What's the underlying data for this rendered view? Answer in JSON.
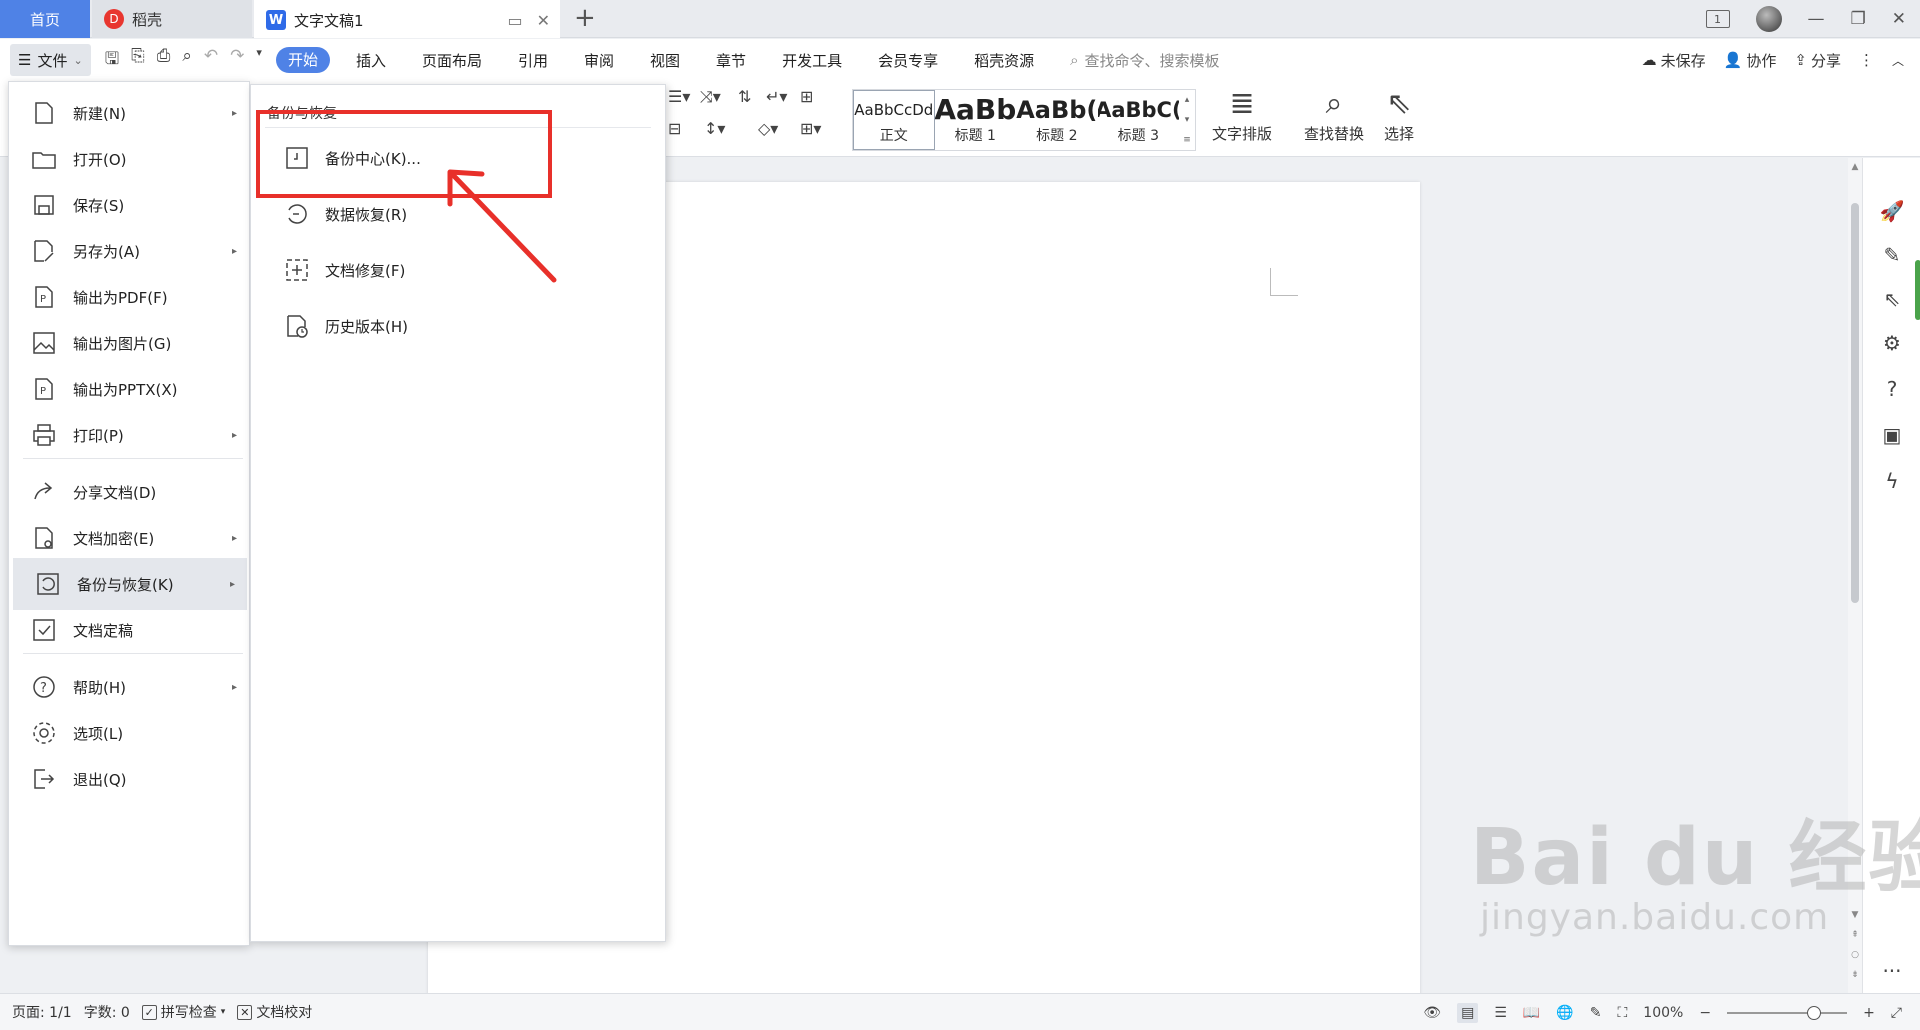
{
  "tabs": {
    "home": "首页",
    "daoke": "稻壳",
    "document": "文字文稿1",
    "new_tab": "+"
  },
  "window": {
    "badge": "1"
  },
  "menu": {
    "file_label": "文件",
    "ribbon_tabs": [
      "开始",
      "插入",
      "页面布局",
      "引用",
      "审阅",
      "视图",
      "章节",
      "开发工具",
      "会员专享",
      "稻壳资源"
    ],
    "search_placeholder": "查找命令、搜索模板",
    "unsaved": "未保存",
    "collab": "协作",
    "share": "分享"
  },
  "ribbon": {
    "styles": [
      {
        "sample": "AaBbCcDd",
        "label": "正文"
      },
      {
        "sample": "AaBb",
        "label": "标题 1"
      },
      {
        "sample": "AaBb(",
        "label": "标题 2"
      },
      {
        "sample": "AaBbC(",
        "label": "标题 3"
      }
    ],
    "text_layout": "文字排版",
    "find_replace": "查找替换",
    "select": "选择"
  },
  "file_menu": {
    "items": [
      {
        "label": "新建(N)",
        "icon": "new-doc-icon",
        "submenu": true
      },
      {
        "label": "打开(O)",
        "icon": "folder-open-icon",
        "submenu": false
      },
      {
        "label": "保存(S)",
        "icon": "save-icon",
        "submenu": false
      },
      {
        "label": "另存为(A)",
        "icon": "save-as-icon",
        "submenu": true
      },
      {
        "label": "输出为PDF(F)",
        "icon": "pdf-export-icon",
        "submenu": false
      },
      {
        "label": "输出为图片(G)",
        "icon": "image-export-icon",
        "submenu": false
      },
      {
        "label": "输出为PPTX(X)",
        "icon": "pptx-export-icon",
        "submenu": false
      },
      {
        "label": "打印(P)",
        "icon": "printer-icon",
        "submenu": true
      },
      {
        "label": "分享文档(D)",
        "icon": "share-icon",
        "submenu": false
      },
      {
        "label": "文档加密(E)",
        "icon": "encrypt-icon",
        "submenu": true
      },
      {
        "label": "备份与恢复(K)",
        "icon": "backup-icon",
        "submenu": true,
        "highlighted": true
      },
      {
        "label": "文档定稿",
        "icon": "finalize-icon",
        "submenu": false
      },
      {
        "label": "帮助(H)",
        "icon": "help-icon",
        "submenu": true
      },
      {
        "label": "选项(L)",
        "icon": "settings-icon",
        "submenu": false
      },
      {
        "label": "退出(Q)",
        "icon": "exit-icon",
        "submenu": false
      }
    ]
  },
  "submenu": {
    "title": "备份与恢复",
    "items": [
      {
        "label": "备份中心(K)...",
        "icon": "backup-center-icon"
      },
      {
        "label": "数据恢复(R)",
        "icon": "data-recovery-icon"
      },
      {
        "label": "文档修复(F)",
        "icon": "doc-repair-icon"
      },
      {
        "label": "历史版本(H)",
        "icon": "history-version-icon"
      }
    ]
  },
  "status": {
    "page": "页面: 1/1",
    "word_count": "字数: 0",
    "spell_check": "拼写检查",
    "doc_proof": "文档校对",
    "zoom": "100%"
  },
  "watermark": {
    "main": "Bai du 经验",
    "sub": "jingyan.baidu.com"
  },
  "colors": {
    "accent": "#4f82e6",
    "annotation_red": "#e8302a"
  }
}
